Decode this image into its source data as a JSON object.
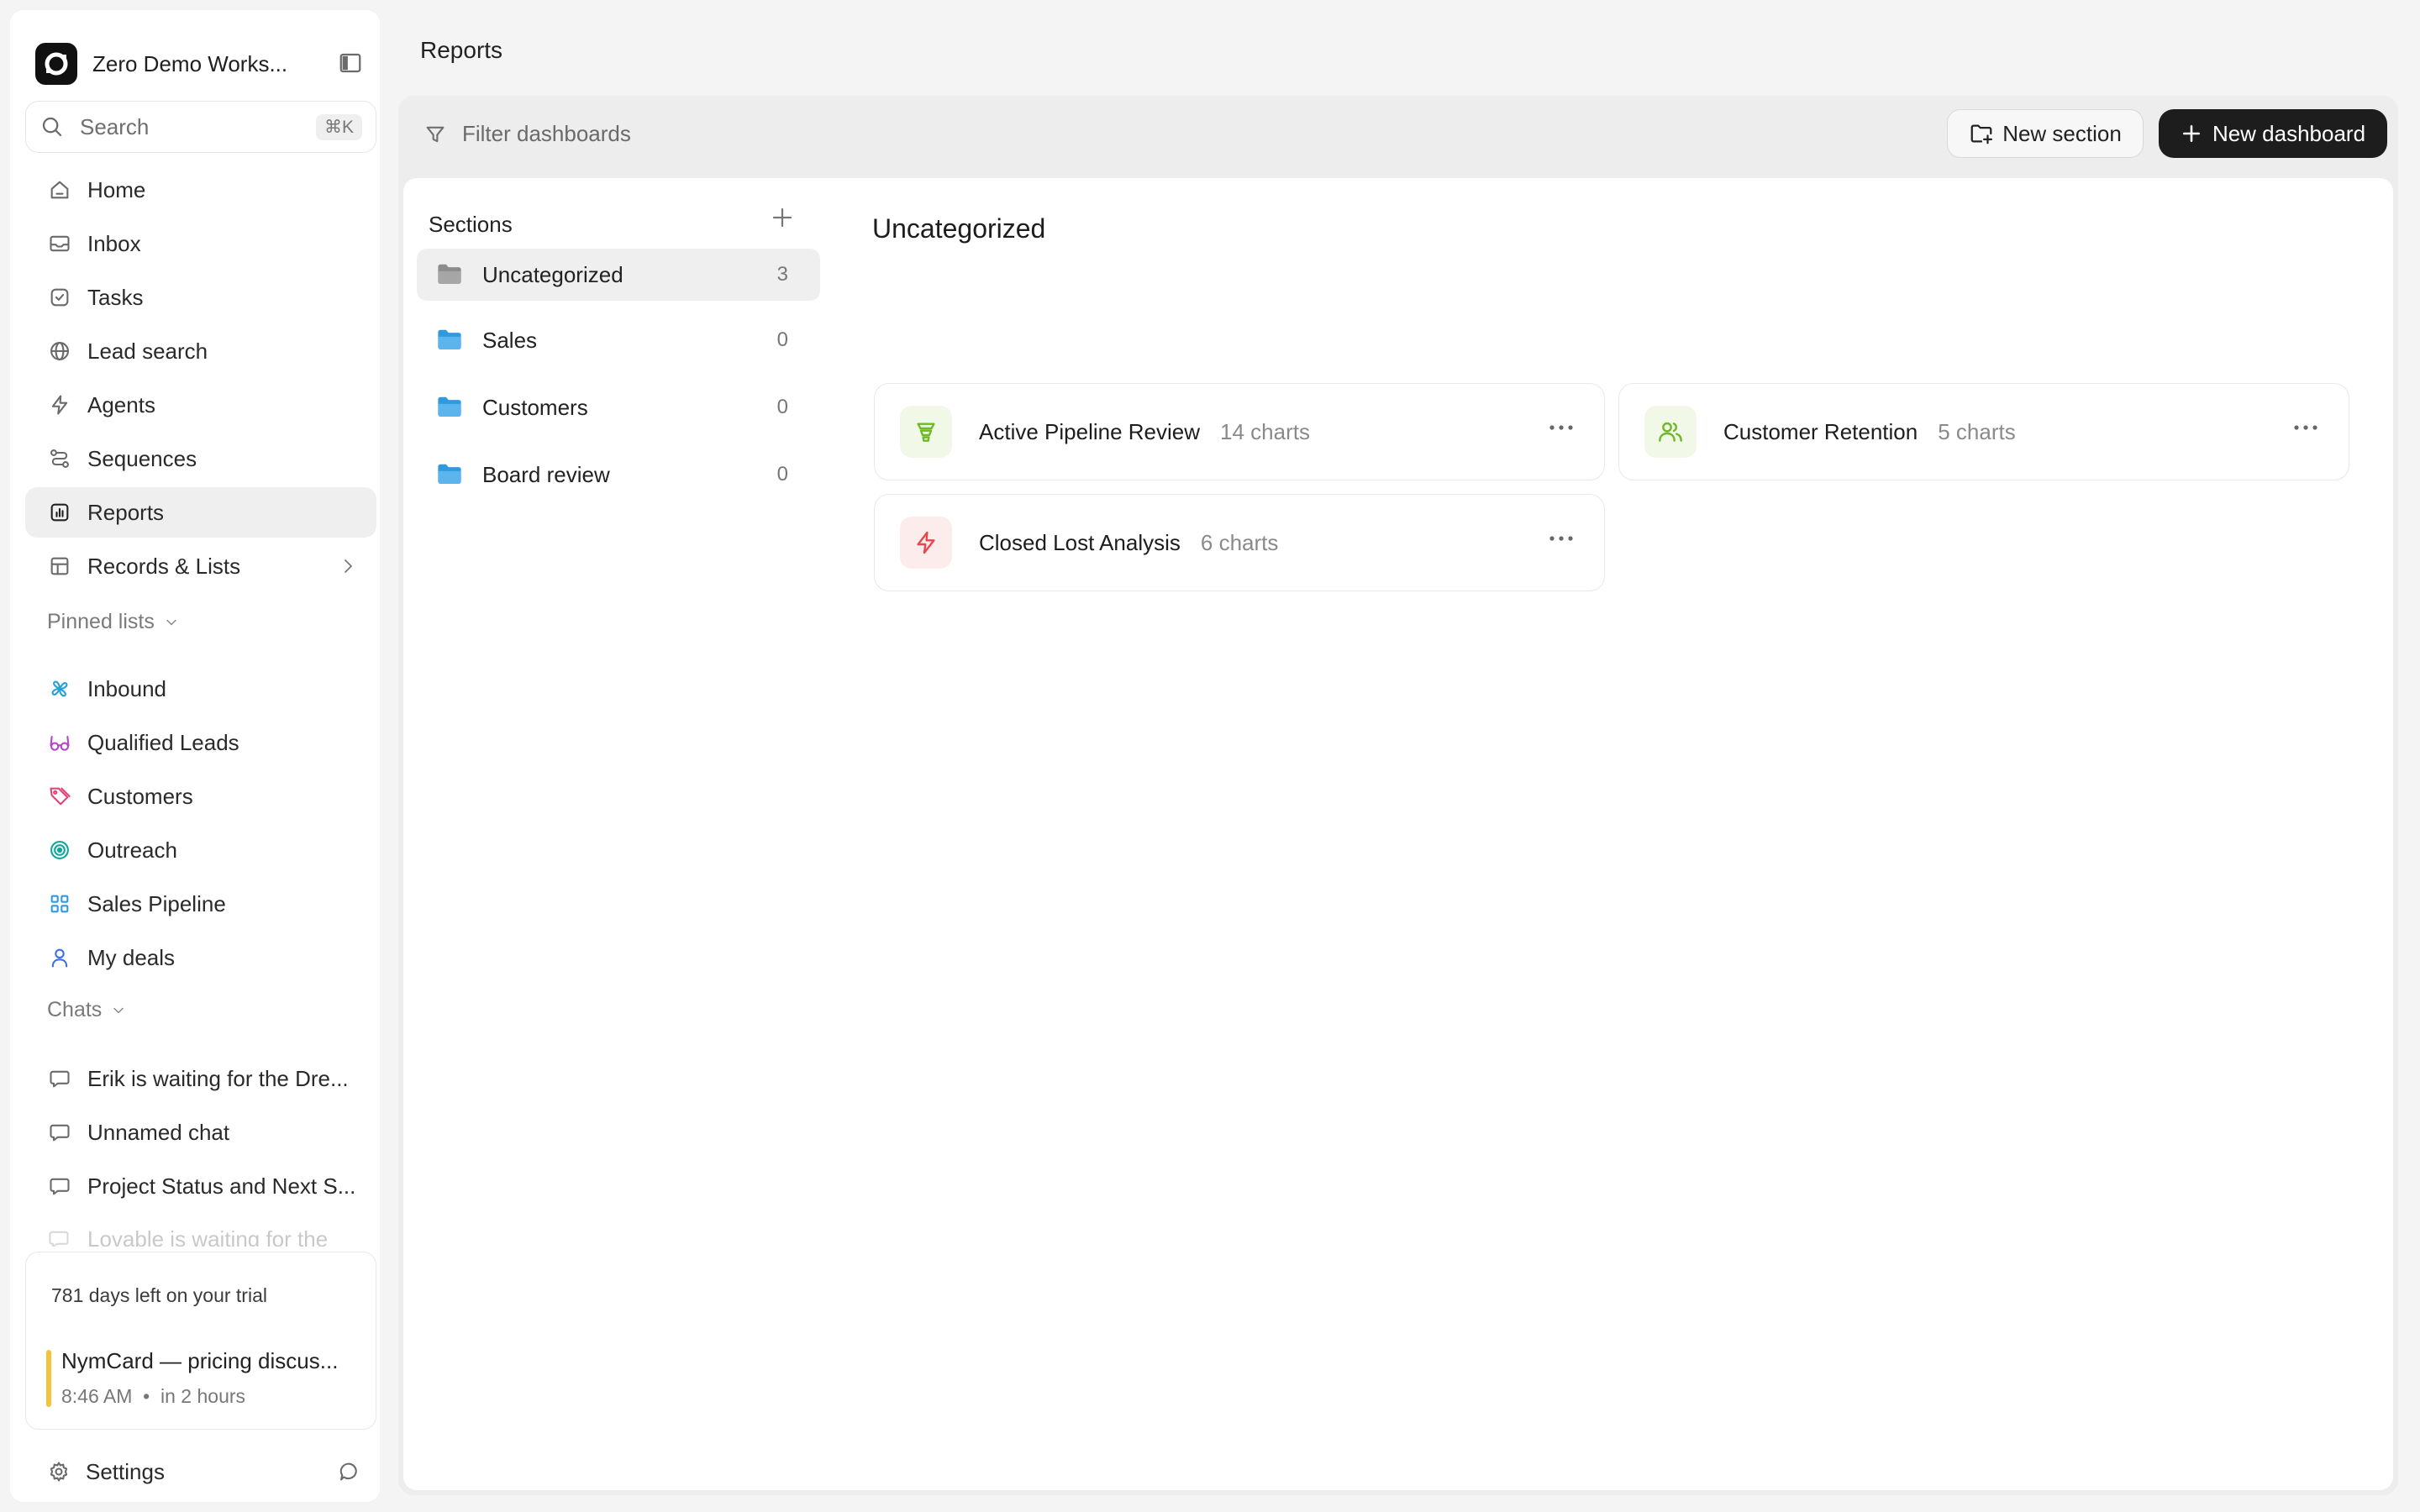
{
  "workspace": {
    "name": "Zero Demo Works..."
  },
  "search": {
    "label": "Search",
    "shortcut": "⌘K"
  },
  "nav": [
    {
      "label": "Home",
      "icon": "home-icon"
    },
    {
      "label": "Inbox",
      "icon": "inbox-icon"
    },
    {
      "label": "Tasks",
      "icon": "tasks-icon"
    },
    {
      "label": "Lead search",
      "icon": "globe-icon"
    },
    {
      "label": "Agents",
      "icon": "bolt-icon"
    },
    {
      "label": "Sequences",
      "icon": "sequences-icon"
    },
    {
      "label": "Reports",
      "icon": "reports-icon",
      "active": true
    },
    {
      "label": "Records & Lists",
      "icon": "table-icon"
    }
  ],
  "pinned": {
    "label": "Pinned lists",
    "items": [
      {
        "label": "Inbound",
        "icon": "pinwheel-icon",
        "color": "#27a0d6"
      },
      {
        "label": "Qualified Leads",
        "icon": "glasses-icon",
        "color": "#b545c9"
      },
      {
        "label": "Customers",
        "icon": "tag-icon",
        "color": "#e0457b"
      },
      {
        "label": "Outreach",
        "icon": "target-icon",
        "color": "#13a79b"
      },
      {
        "label": "Sales Pipeline",
        "icon": "grid-icon",
        "color": "#2e9ae0"
      },
      {
        "label": "My deals",
        "icon": "user-icon",
        "color": "#3d6fe0"
      }
    ]
  },
  "chats": {
    "label": "Chats",
    "items": [
      {
        "label": "Erik is waiting for the Dre..."
      },
      {
        "label": "Unnamed chat"
      },
      {
        "label": "Project Status and Next S..."
      },
      {
        "label": "Lovable is waiting for the"
      }
    ]
  },
  "trial": {
    "text": "781 days left on your trial"
  },
  "meeting": {
    "title": "NymCard — pricing discus...",
    "time": "8:46 AM",
    "relative": "in 2 hours",
    "color": "#f4c33a"
  },
  "settings": {
    "label": "Settings"
  },
  "page": {
    "title": "Reports"
  },
  "toolbar": {
    "filter_placeholder": "Filter dashboards",
    "new_section": "New section",
    "new_dashboard": "New dashboard"
  },
  "sections": {
    "header": "Sections",
    "items": [
      {
        "label": "Uncategorized",
        "count": "3",
        "active": true,
        "color": "#7a7a7a"
      },
      {
        "label": "Sales",
        "count": "0",
        "color": "#2e9ae0"
      },
      {
        "label": "Customers",
        "count": "0",
        "color": "#2e9ae0"
      },
      {
        "label": "Board review",
        "count": "0",
        "color": "#2e9ae0"
      }
    ]
  },
  "category": {
    "title": "Uncategorized"
  },
  "dashboards": [
    {
      "title": "Active Pipeline Review",
      "count": "14 charts",
      "icon": "funnel-icon",
      "color": "#6fb82a",
      "bg": "#f1f8e8"
    },
    {
      "title": "Customer Retention",
      "count": "5 charts",
      "icon": "users-icon",
      "color": "#6fb82a",
      "bg": "#f1f8e8"
    },
    {
      "title": "Closed Lost Analysis",
      "count": "6 charts",
      "icon": "bolt-icon",
      "color": "#e5484d",
      "bg": "#fdecec"
    }
  ]
}
